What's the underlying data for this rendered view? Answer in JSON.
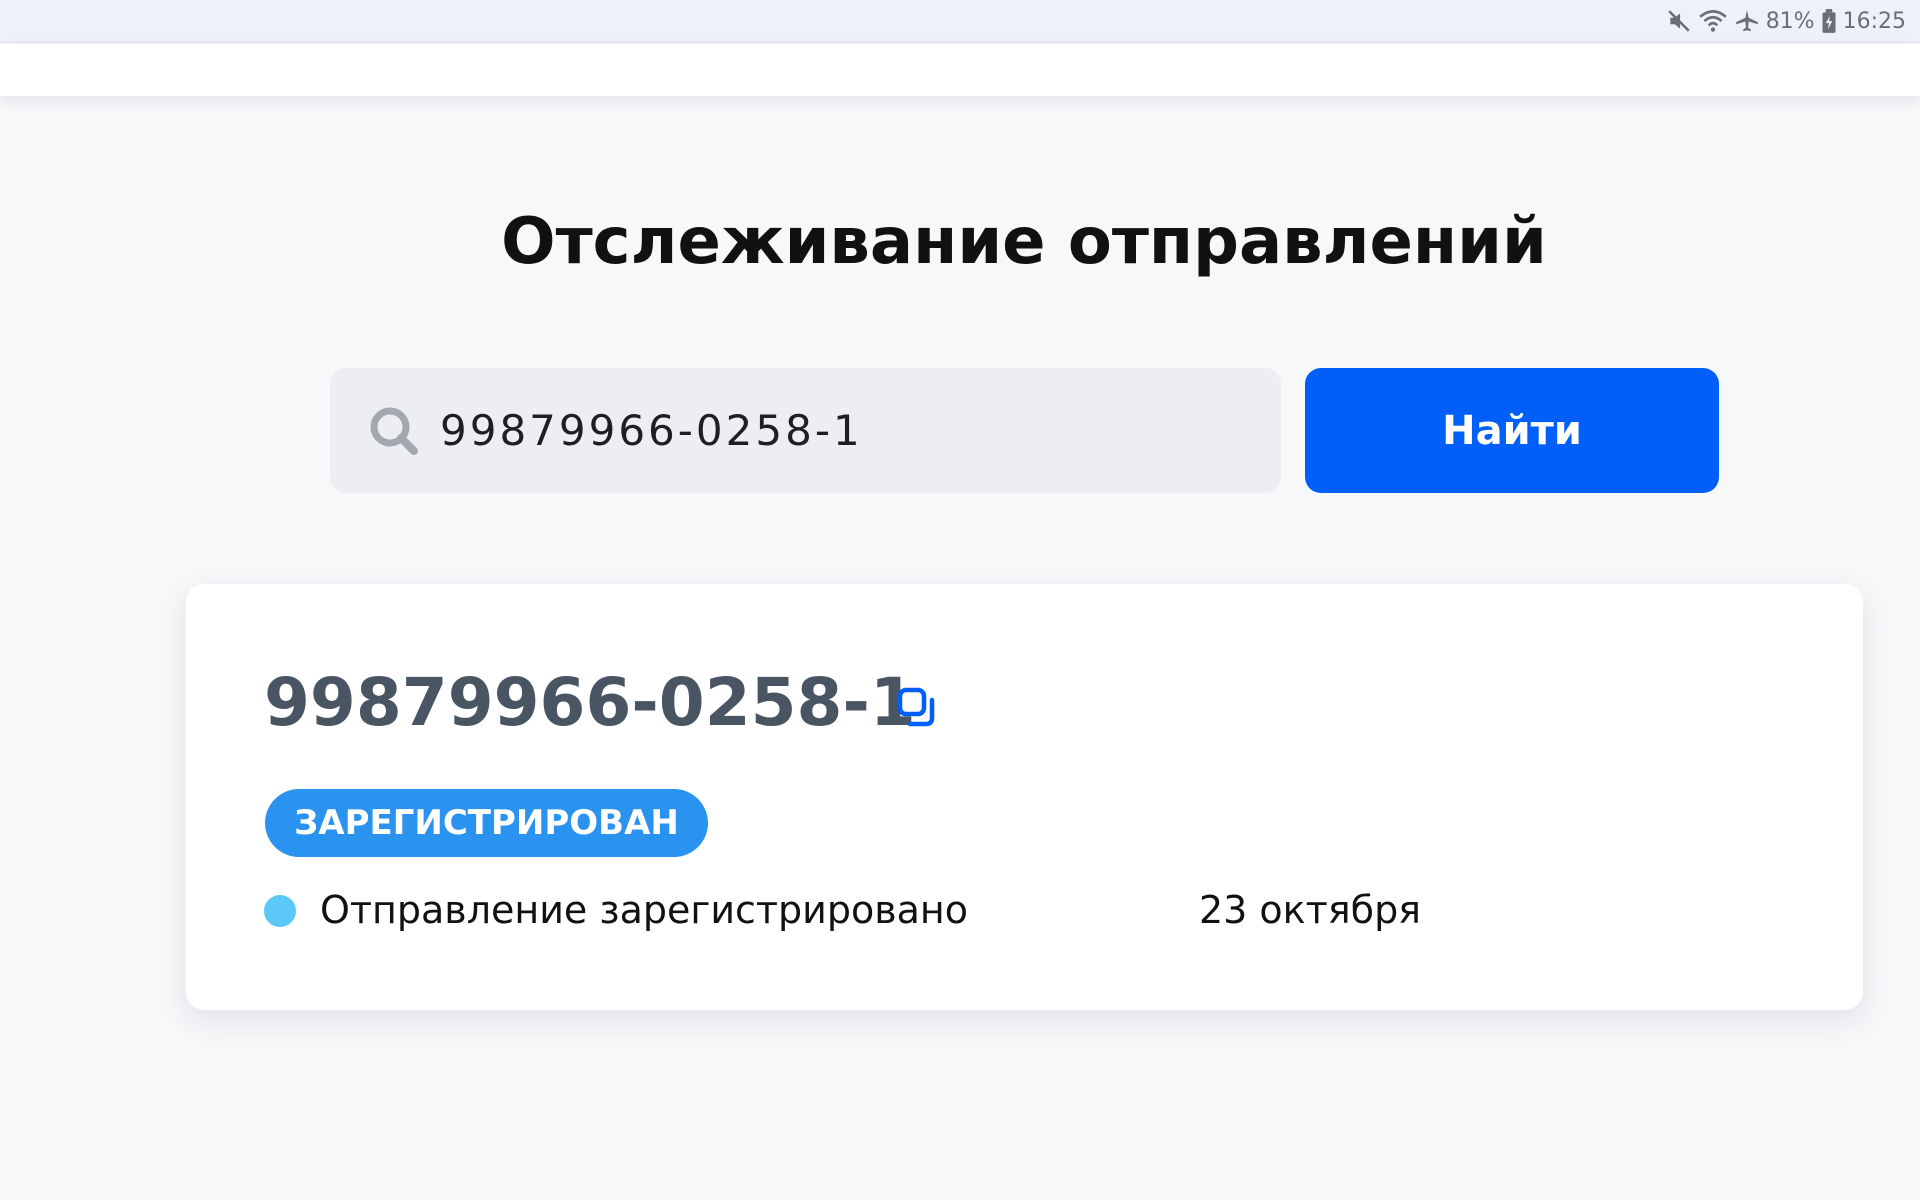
{
  "status_bar": {
    "battery": "81%",
    "time": "16:25",
    "icons": [
      "mute-icon",
      "wifi-icon",
      "airplane-icon",
      "battery-icon"
    ]
  },
  "page": {
    "title": "Отслеживание отправлений"
  },
  "search": {
    "value": "99879966-0258-1",
    "button_label": "Найти",
    "icon": "search-icon"
  },
  "result": {
    "track_number": "99879966-0258-1",
    "status_badge": "ЗАРЕГИСТРИРОВАН",
    "events": [
      {
        "text": "Отправление зарегистрировано",
        "date": "23 октября"
      }
    ]
  },
  "colors": {
    "accent": "#005ff9",
    "badge": "#2a93f0",
    "event_dot": "#5bc8f7",
    "track_number": "#4a5563"
  }
}
